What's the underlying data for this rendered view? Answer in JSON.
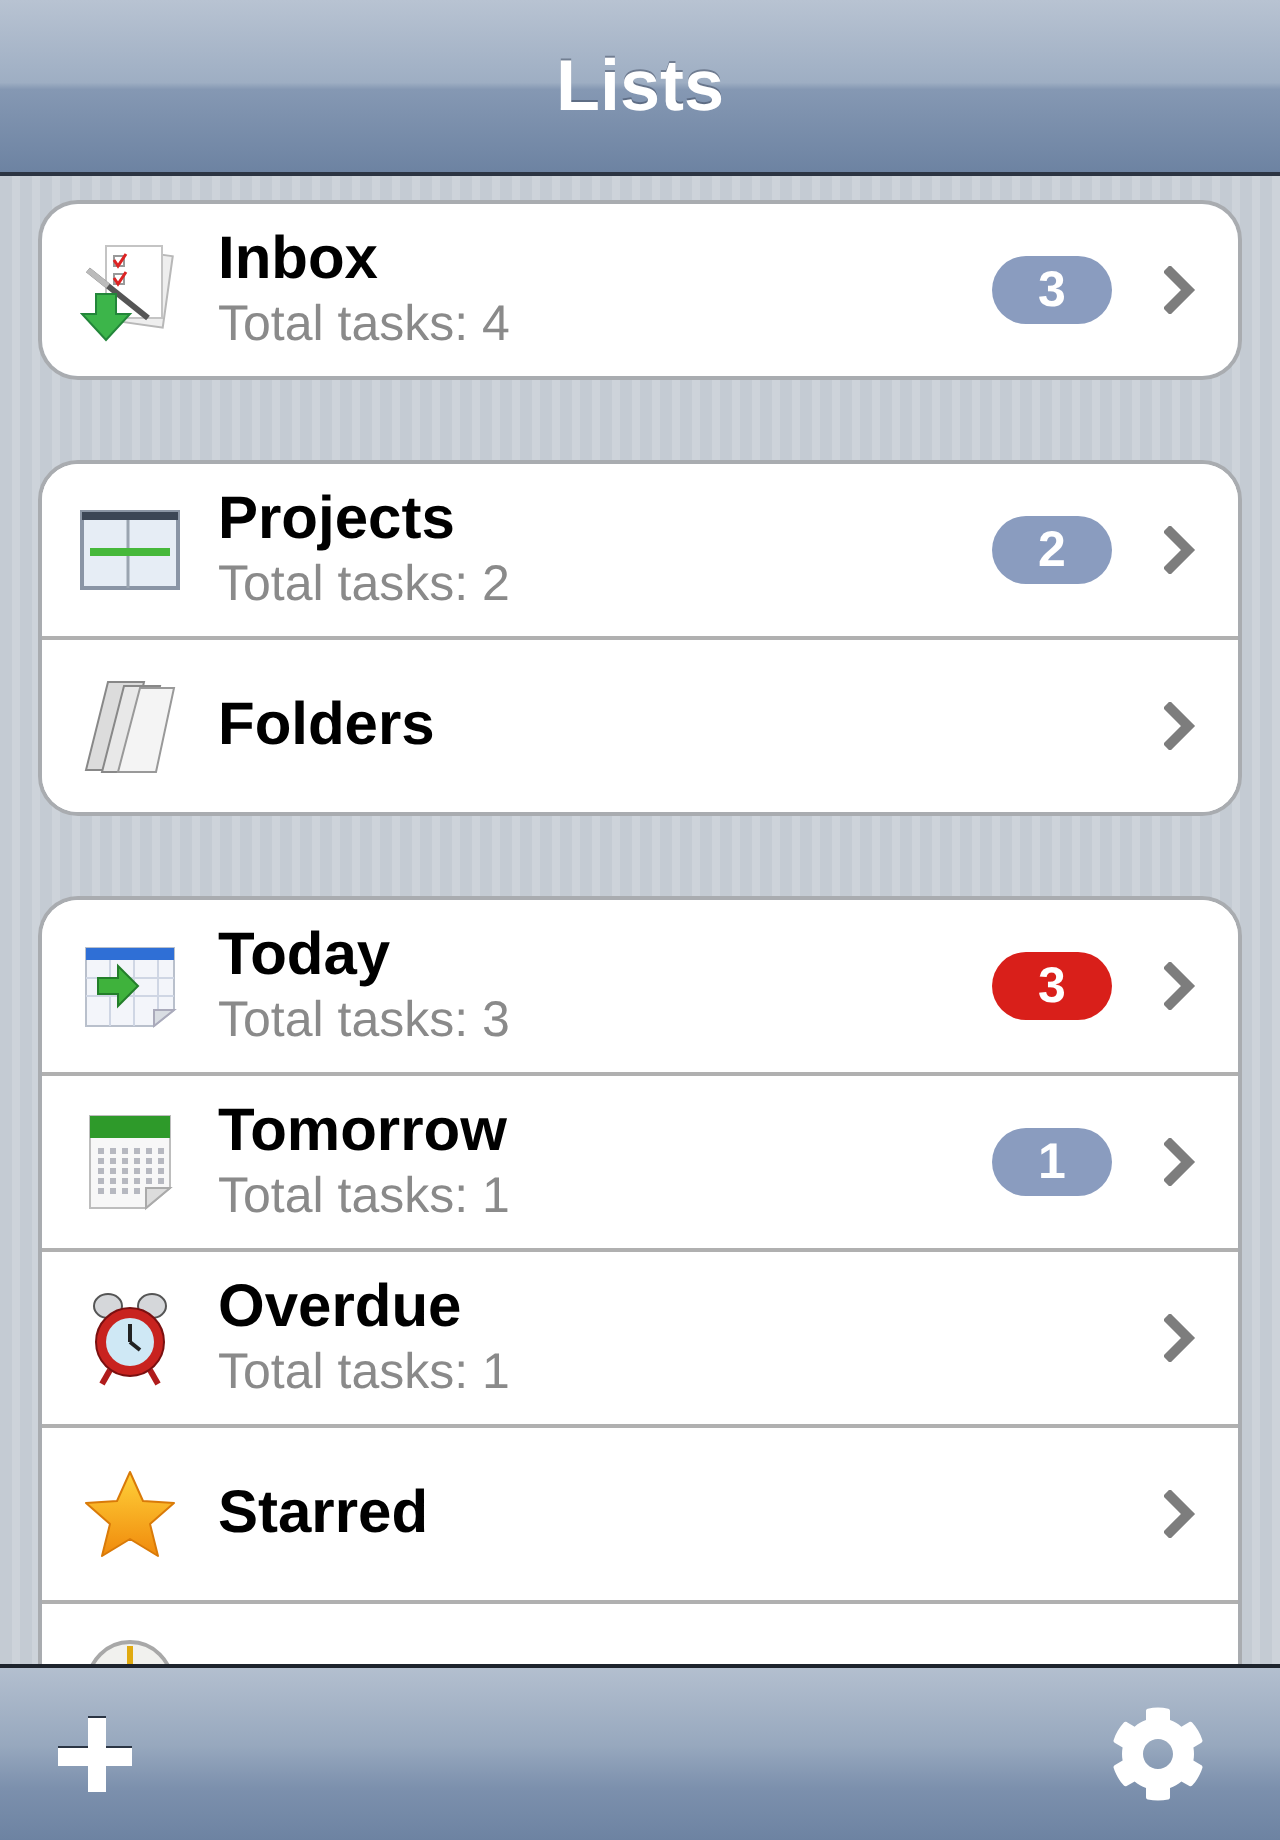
{
  "nav_bar": {
    "title": "Lists"
  },
  "sections": [
    {
      "items": [
        {
          "kind": "row",
          "title": "Inbox",
          "subtitle": "Total tasks: 4",
          "badge": {
            "count": "3",
            "color": "#8a9cbf"
          }
        }
      ]
    },
    {
      "items": [
        {
          "kind": "row",
          "title": "Projects",
          "subtitle": "Total tasks: 2",
          "badge": {
            "count": "2",
            "color": "#8a9cbf"
          }
        },
        {
          "kind": "row",
          "title": "Folders"
        }
      ]
    },
    {
      "items": [
        {
          "kind": "row",
          "title": "Today",
          "subtitle": "Total tasks: 3",
          "badge": {
            "count": "3",
            "color": "#d91f1a"
          }
        },
        {
          "kind": "row",
          "title": "Tomorrow",
          "subtitle": "Total tasks: 1",
          "badge": {
            "count": "1",
            "color": "#8a9cbf"
          }
        },
        {
          "kind": "row",
          "title": "Overdue",
          "subtitle": "Total tasks: 1"
        },
        {
          "kind": "row",
          "title": "Starred"
        },
        {
          "kind": "clipped"
        }
      ]
    }
  ]
}
